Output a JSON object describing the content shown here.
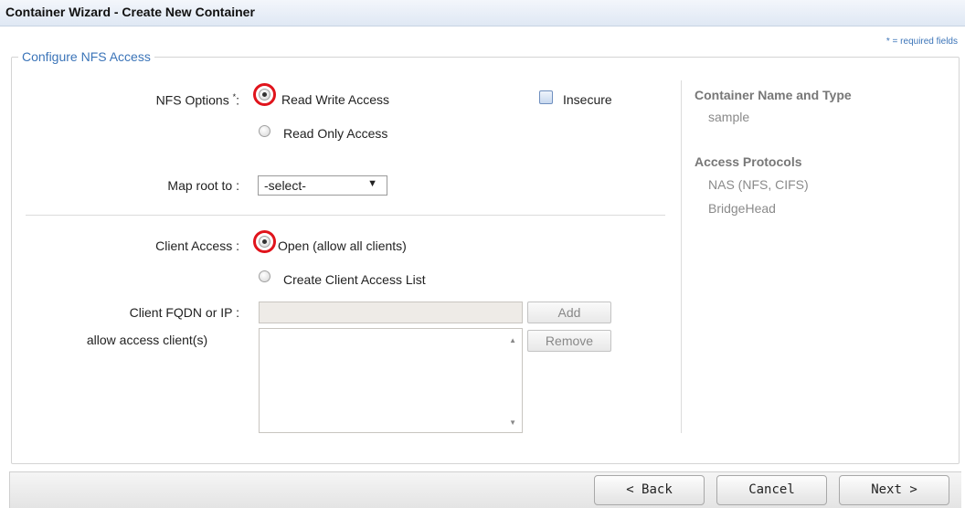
{
  "window": {
    "title": "Container Wizard - Create New Container"
  },
  "required_note": "* = required fields",
  "section": {
    "legend": "Configure NFS Access"
  },
  "nfs_options": {
    "label": "NFS Options",
    "required_mark": "*",
    "colon": ":",
    "options": [
      {
        "label": "Read Write Access",
        "selected": true
      },
      {
        "label": "Read Only Access",
        "selected": false
      }
    ],
    "insecure_label": "Insecure",
    "insecure_checked": false
  },
  "map_root": {
    "label": "Map root to :",
    "selected": "-select-"
  },
  "client_access": {
    "label": "Client Access :",
    "options": [
      {
        "label": "Open (allow all clients)",
        "selected": true
      },
      {
        "label": "Create Client Access List",
        "selected": false
      }
    ]
  },
  "client_fqdn": {
    "label": "Client FQDN or IP :",
    "value": "",
    "add_label": "Add"
  },
  "allow_clients": {
    "label": "allow access client(s)",
    "remove_label": "Remove"
  },
  "summary": {
    "name_type_heading": "Container Name and Type",
    "name_value": "sample",
    "protocols_heading": "Access Protocols",
    "protocols": [
      "NAS (NFS, CIFS)",
      "BridgeHead"
    ]
  },
  "footer": {
    "back_label": "< Back",
    "cancel_label": "Cancel",
    "next_label": "Next >"
  },
  "colors": {
    "accent": "#3b74b8",
    "highlight_ring": "#e0141c"
  }
}
